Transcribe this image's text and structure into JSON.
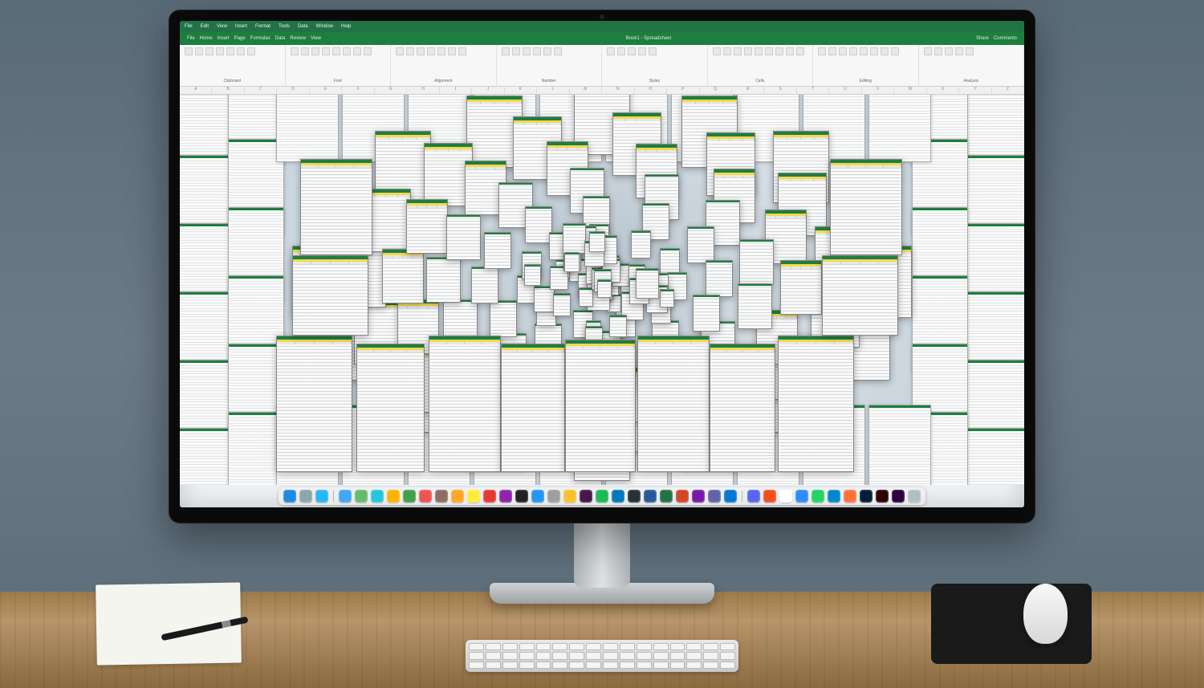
{
  "scene": {
    "description": "Stylized illustration of an iMac-style monitor on a wooden desk showing a spreadsheet application (Excel-like) with many overlapping spreadsheet windows arranged in a spiraling/recursive pattern, with a macOS-style dock at the bottom.",
    "desk_items": [
      "paper-stack",
      "pen",
      "keyboard",
      "mousepad",
      "mouse"
    ]
  },
  "app": {
    "brand_color": "#217346",
    "title_left": [
      "File",
      "Home",
      "Insert",
      "Page",
      "Formulas",
      "Data",
      "Review",
      "View"
    ],
    "title_center": "Book1 - Spreadsheet",
    "title_right": [
      "Share",
      "Comments"
    ],
    "menu": [
      "File",
      "Edit",
      "View",
      "Insert",
      "Format",
      "Tools",
      "Data",
      "Window",
      "Help"
    ],
    "ribbon_groups": [
      {
        "label": "Clipboard"
      },
      {
        "label": "Font"
      },
      {
        "label": "Alignment"
      },
      {
        "label": "Number"
      },
      {
        "label": "Styles"
      },
      {
        "label": "Cells"
      },
      {
        "label": "Editing"
      },
      {
        "label": "Analysis"
      }
    ],
    "ruler_cols": [
      "A",
      "B",
      "C",
      "D",
      "E",
      "F",
      "G",
      "H",
      "I",
      "J",
      "K",
      "L",
      "M",
      "N",
      "O",
      "P",
      "Q",
      "R",
      "S",
      "T",
      "U",
      "V",
      "W",
      "X",
      "Y",
      "Z"
    ]
  },
  "dock": {
    "apps": [
      {
        "name": "finder",
        "color": "#1e88e5"
      },
      {
        "name": "launchpad",
        "color": "#90a4ae"
      },
      {
        "name": "safari",
        "color": "#29b6f6"
      },
      {
        "name": "mail",
        "color": "#42a5f5"
      },
      {
        "name": "messages",
        "color": "#66bb6a"
      },
      {
        "name": "maps",
        "color": "#26c6da"
      },
      {
        "name": "photos",
        "color": "#ffb300"
      },
      {
        "name": "facetime",
        "color": "#43a047"
      },
      {
        "name": "calendar",
        "color": "#ef5350"
      },
      {
        "name": "contacts",
        "color": "#8d6e63"
      },
      {
        "name": "reminders",
        "color": "#ffa726"
      },
      {
        "name": "notes",
        "color": "#ffeb3b"
      },
      {
        "name": "music",
        "color": "#e53935"
      },
      {
        "name": "podcasts",
        "color": "#8e24aa"
      },
      {
        "name": "tv",
        "color": "#212121"
      },
      {
        "name": "appstore",
        "color": "#2196f3"
      },
      {
        "name": "settings",
        "color": "#9e9e9e"
      },
      {
        "name": "chrome",
        "color": "#fbc02d"
      },
      {
        "name": "slack",
        "color": "#4a154b"
      },
      {
        "name": "spotify",
        "color": "#1db954"
      },
      {
        "name": "vscode",
        "color": "#0277bd"
      },
      {
        "name": "terminal",
        "color": "#263238"
      },
      {
        "name": "word",
        "color": "#2b579a"
      },
      {
        "name": "excel",
        "color": "#217346"
      },
      {
        "name": "powerpoint",
        "color": "#d24726"
      },
      {
        "name": "onenote",
        "color": "#7719aa"
      },
      {
        "name": "teams",
        "color": "#6264a7"
      },
      {
        "name": "outlook",
        "color": "#0078d4"
      },
      {
        "name": "discord",
        "color": "#5865f2"
      },
      {
        "name": "figma",
        "color": "#f24e1e"
      },
      {
        "name": "notion",
        "color": "#ffffff"
      },
      {
        "name": "zoom",
        "color": "#2d8cff"
      },
      {
        "name": "whatsapp",
        "color": "#25d366"
      },
      {
        "name": "telegram",
        "color": "#0088cc"
      },
      {
        "name": "firefox",
        "color": "#ff7139"
      },
      {
        "name": "photoshop",
        "color": "#001e36"
      },
      {
        "name": "illustrator",
        "color": "#330000"
      },
      {
        "name": "premiere",
        "color": "#2a003f"
      },
      {
        "name": "trash",
        "color": "#b0bec5"
      }
    ]
  },
  "overlap_note": "Dozens of small spreadsheet windows overlap in a vortex pattern; each shows a green title bar, occasional yellow toolbar, gray column headers, and dense numeric cell rows. Text in individual cells is illegible/decorative."
}
